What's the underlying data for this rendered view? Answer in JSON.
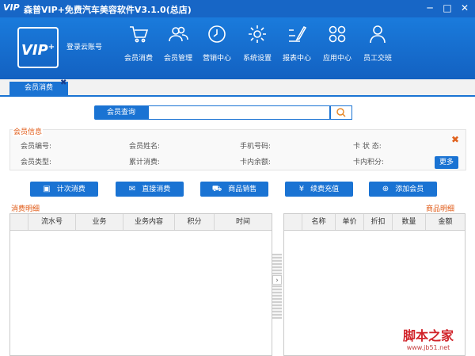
{
  "window": {
    "logo": "VIP",
    "title": "森普VIP+免费汽车美容软件V3.1.0(总店)",
    "minimize": "─",
    "maximize": "□",
    "close": "✕"
  },
  "header": {
    "logo_text": "VIP",
    "logo_plus": "+",
    "login": "登录云账号",
    "nav": [
      {
        "label": "会员消费",
        "icon": "cart-icon"
      },
      {
        "label": "会员管理",
        "icon": "users-icon"
      },
      {
        "label": "营销中心",
        "icon": "clock-icon"
      },
      {
        "label": "系统设置",
        "icon": "gear-icon"
      },
      {
        "label": "报表中心",
        "icon": "report-icon"
      },
      {
        "label": "应用中心",
        "icon": "apps-icon"
      },
      {
        "label": "员工交班",
        "icon": "person-icon"
      }
    ]
  },
  "tabs": [
    {
      "label": "会员消费",
      "close": "✖"
    }
  ],
  "search": {
    "label": "会员查询",
    "value": "",
    "placeholder": ""
  },
  "member_info": {
    "title": "会员信息",
    "fields": [
      "会员编号:",
      "会员姓名:",
      "手机号码:",
      "卡 状 态:",
      "会员类型:",
      "累计消费:",
      "卡内余额:",
      "卡内积分:"
    ],
    "close": "✖",
    "more": "更多"
  },
  "actions": [
    "计次消费",
    "直接消费",
    "商品销售",
    "续费充值",
    "添加会员"
  ],
  "consumption": {
    "title": "消费明细",
    "columns": [
      "流水号",
      "业务",
      "业务内容",
      "积分",
      "时间"
    ]
  },
  "products": {
    "title": "商品明细",
    "columns": [
      "名称",
      "单价",
      "折扣",
      "数量",
      "金额"
    ]
  },
  "splitter_arrow": "›",
  "watermark": {
    "line1": "脚本之家",
    "line2": "www.jb51.net"
  },
  "colors": {
    "brand": "#1a73d3",
    "accent": "#e05a16"
  }
}
